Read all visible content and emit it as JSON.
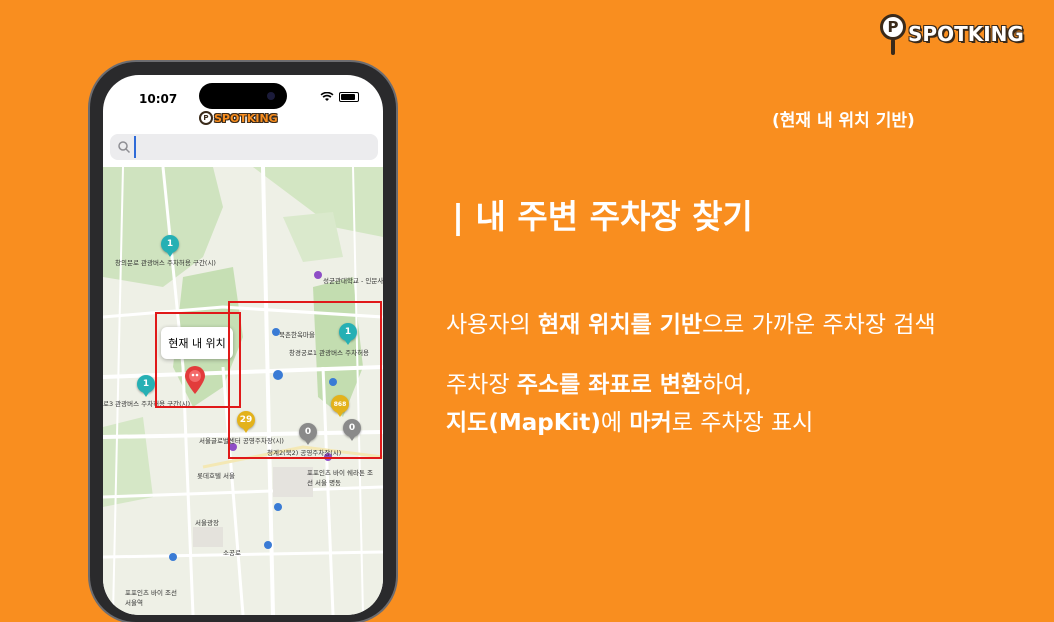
{
  "brand": {
    "logo_letter": "P",
    "name": "SPOTKING"
  },
  "tag": "(현재 내 위치 기반)",
  "title": "| 내 주변 주차장 찾기",
  "desc1": {
    "a": "사용자의 ",
    "b": "현재 위치를 기반",
    "c": "으로 가까운 주차장 검색"
  },
  "desc2": {
    "a": "주차장 ",
    "b": "주소를 좌표로 변환",
    "c": "하여,"
  },
  "desc3": {
    "a": "지도(MapKit)",
    "b": "에 ",
    "c": "마커",
    "d": "로 주차장 표시"
  },
  "phone": {
    "time": "10:07",
    "app_logo": "SPOTKING",
    "search": {
      "value": ""
    },
    "callout": "현재 내 위치",
    "markers": [
      {
        "count": "1",
        "label": "창의문로 관광버스 주차허용 구간(시)",
        "color": "#26b0b4"
      },
      {
        "count": "1",
        "label": "창경궁로1 관광버스 주차허용",
        "color": "#26b0b4"
      },
      {
        "count": "1",
        "label": "로3 관광버스 주차허용 구간(시)",
        "color": "#26b0b4"
      },
      {
        "count": "29",
        "label": "서울글로벌센터 공영주차장(시)",
        "color": "#e3b21b"
      },
      {
        "count": "0",
        "label": "청계2(북2) 공영주차장(시)",
        "color": "#8a8a8a"
      },
      {
        "count": "0",
        "label": "",
        "color": "#8a8a8a"
      },
      {
        "count": "868",
        "label": "",
        "color": "#e3b21b"
      }
    ],
    "map_labels": {
      "univ": "성균관대학교 - 인문사회과학캠",
      "museum": "북촌한옥마을",
      "lotte": "롯데호텔 서울",
      "four": "포포인츠 바이 쉐라톤 조선 서울 명동",
      "square": "서울광장",
      "four2": "포포인츠 바이 조선 서울역",
      "sogong": "소공로"
    }
  }
}
